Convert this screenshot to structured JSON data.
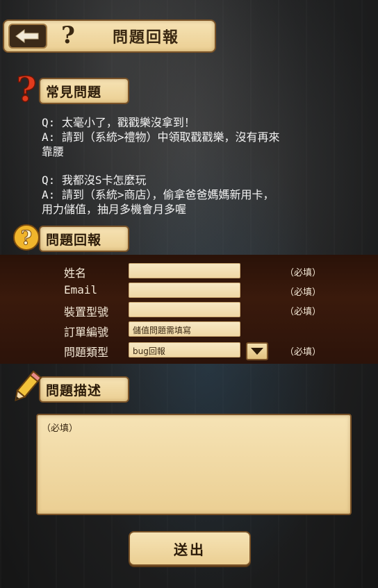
{
  "header": {
    "title": "問題回報",
    "back_icon": "back-arrow-icon",
    "help_icon": "question-mark-icon"
  },
  "faq_section": {
    "title": "常見問題",
    "icon": "red-question-icon",
    "items": [
      {
        "q": "Q: 太毫小了，戳戳樂沒拿到！",
        "a1": "A: 請到（系統>禮物）中領取戳戳樂，沒有再來",
        "a2": "靠腰"
      },
      {
        "q": "Q: 我都沒S卡怎麼玩",
        "a1": "A: 請到（系統>商店），偷拿爸爸媽媽新用卡，",
        "a2": "用力儲值，抽月多機會月多喔"
      }
    ]
  },
  "report_section": {
    "title": "問題回報",
    "icon": "gold-question-icon",
    "fields": [
      {
        "label": "姓名",
        "value": "",
        "required": "（必填）"
      },
      {
        "label": "Email",
        "value": "",
        "required": "（必填）"
      },
      {
        "label": "裝置型號",
        "value": "",
        "required": "（必填）"
      },
      {
        "label": "訂單編號",
        "value": "儲值問題需填寫",
        "required": ""
      },
      {
        "label": "問題類型",
        "value": "bug回報",
        "required": "（必填）"
      }
    ]
  },
  "description_section": {
    "title": "問題描述",
    "icon": "pencil-icon",
    "placeholder": "（必填）"
  },
  "submit": {
    "label": "送出"
  },
  "colors": {
    "parchment": "#f6e3b5",
    "border": "#7a5328",
    "band": "#3a1a0c",
    "accent_red": "#e23b1d"
  }
}
